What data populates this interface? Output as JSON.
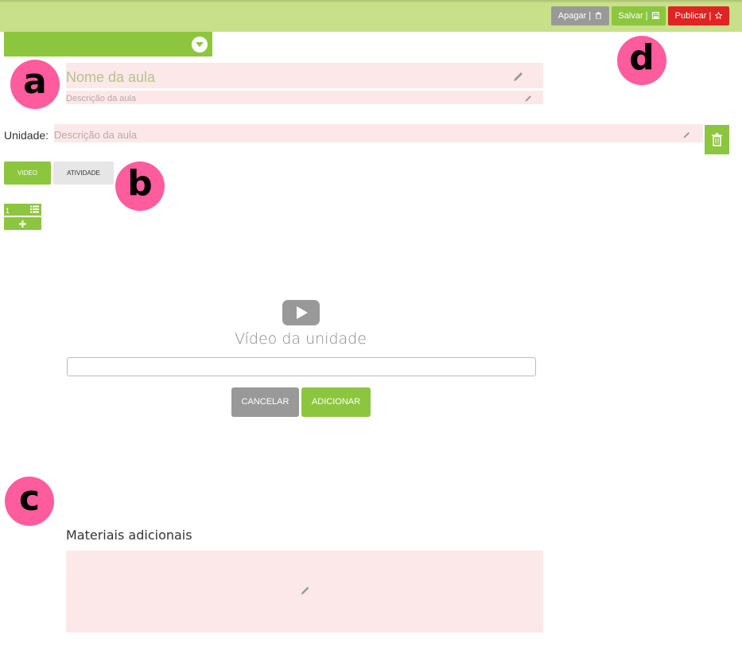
{
  "colors": {
    "topbar": "#c8e08a",
    "accent_green": "#8cc63f",
    "danger_red": "#e02323",
    "neutral_gray": "#999999",
    "pink_field": "#fce8e8",
    "marker_pink": "#ff5c9e"
  },
  "toolbar": {
    "delete_label": "Apagar |",
    "delete_icon": "trash-icon",
    "save_label": "Salvar |",
    "save_icon": "floppy-disk-icon",
    "publish_label": "Publicar |",
    "publish_icon": "star-icon"
  },
  "markers": [
    "a",
    "b",
    "c",
    "d"
  ],
  "lesson": {
    "name_placeholder": "Nome da aula",
    "description_placeholder": "Descrição da aula"
  },
  "unit": {
    "label": "Unidade:",
    "description_placeholder": "Descrição da aula"
  },
  "tabs": [
    {
      "label": "VIDEO",
      "active": true
    },
    {
      "label": "ATIVIDADE",
      "active": false
    }
  ],
  "unit_list": {
    "number": "1",
    "list_icon": "list-icon",
    "add_icon": "plus-icon"
  },
  "video": {
    "icon": "play-icon",
    "title": "Vídeo da unidade",
    "input_value": "",
    "cancel_label": "CANCELAR",
    "add_label": "ADICIONAR"
  },
  "materials": {
    "title": "Materiais adicionais",
    "edit_icon": "pencil-icon"
  }
}
